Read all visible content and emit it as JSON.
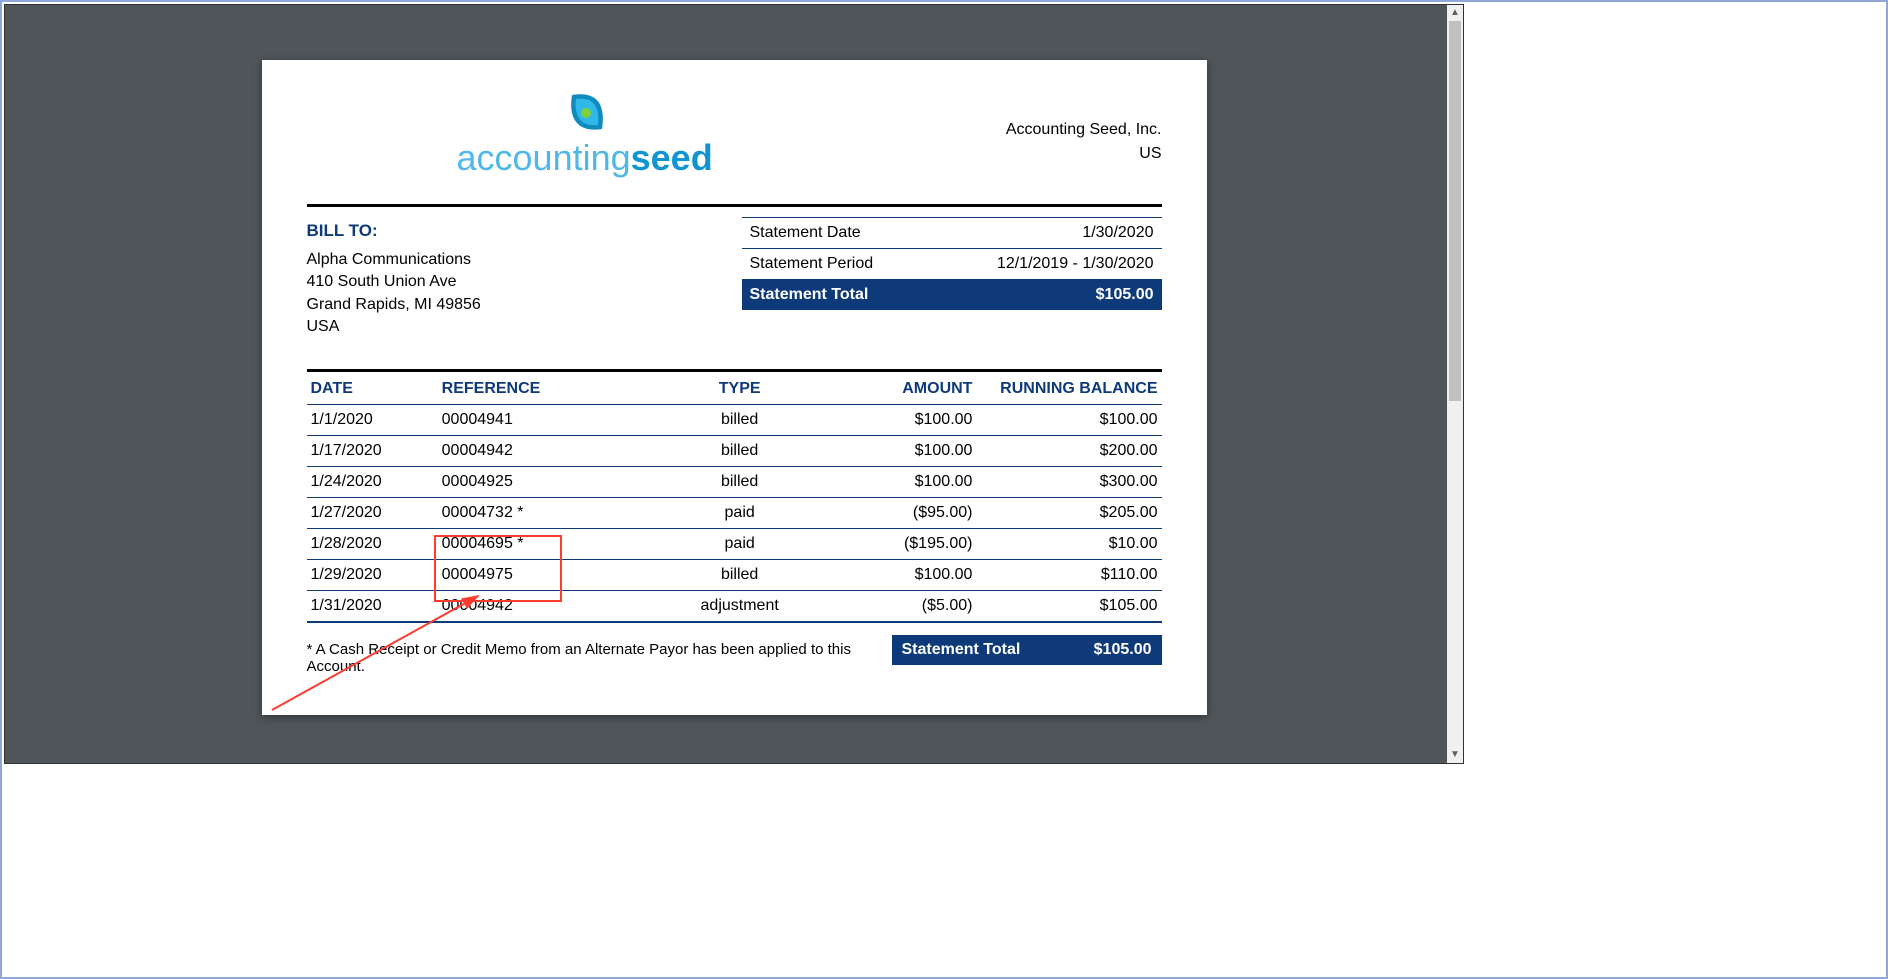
{
  "company": {
    "name": "Accounting Seed, Inc.",
    "country": "US",
    "logo_word1": "accounting",
    "logo_word2": "seed"
  },
  "bill_to": {
    "label": "BILL TO:",
    "name": "Alpha Communications",
    "street": "410 South Union Ave",
    "city_line": "Grand Rapids, MI 49856",
    "country": "USA"
  },
  "summary": {
    "date_label": "Statement Date",
    "date_value": "1/30/2020",
    "period_label": "Statement Period",
    "period_value": "12/1/2019 - 1/30/2020",
    "total_label": "Statement Total",
    "total_value": "$105.00"
  },
  "columns": {
    "date": "DATE",
    "reference": "REFERENCE",
    "type": "TYPE",
    "amount": "AMOUNT",
    "balance": "RUNNING BALANCE"
  },
  "rows": [
    {
      "date": "1/1/2020",
      "reference": "00004941",
      "type": "billed",
      "amount": "$100.00",
      "balance": "$100.00"
    },
    {
      "date": "1/17/2020",
      "reference": "00004942",
      "type": "billed",
      "amount": "$100.00",
      "balance": "$200.00"
    },
    {
      "date": "1/24/2020",
      "reference": "00004925",
      "type": "billed",
      "amount": "$100.00",
      "balance": "$300.00"
    },
    {
      "date": "1/27/2020",
      "reference": "00004732 *",
      "type": "paid",
      "amount": "($95.00)",
      "balance": "$205.00"
    },
    {
      "date": "1/28/2020",
      "reference": "00004695 *",
      "type": "paid",
      "amount": "($195.00)",
      "balance": "$10.00"
    },
    {
      "date": "1/29/2020",
      "reference": "00004975",
      "type": "billed",
      "amount": "$100.00",
      "balance": "$110.00"
    },
    {
      "date": "1/31/2020",
      "reference": "00004942",
      "type": "adjustment",
      "amount": "($5.00)",
      "balance": "$105.00"
    }
  ],
  "footer": {
    "note": "*  A Cash Receipt or Credit Memo from an Alternate Payor has been applied to this Account.",
    "total_label": "Statement Total",
    "total_value": "$105.00"
  }
}
